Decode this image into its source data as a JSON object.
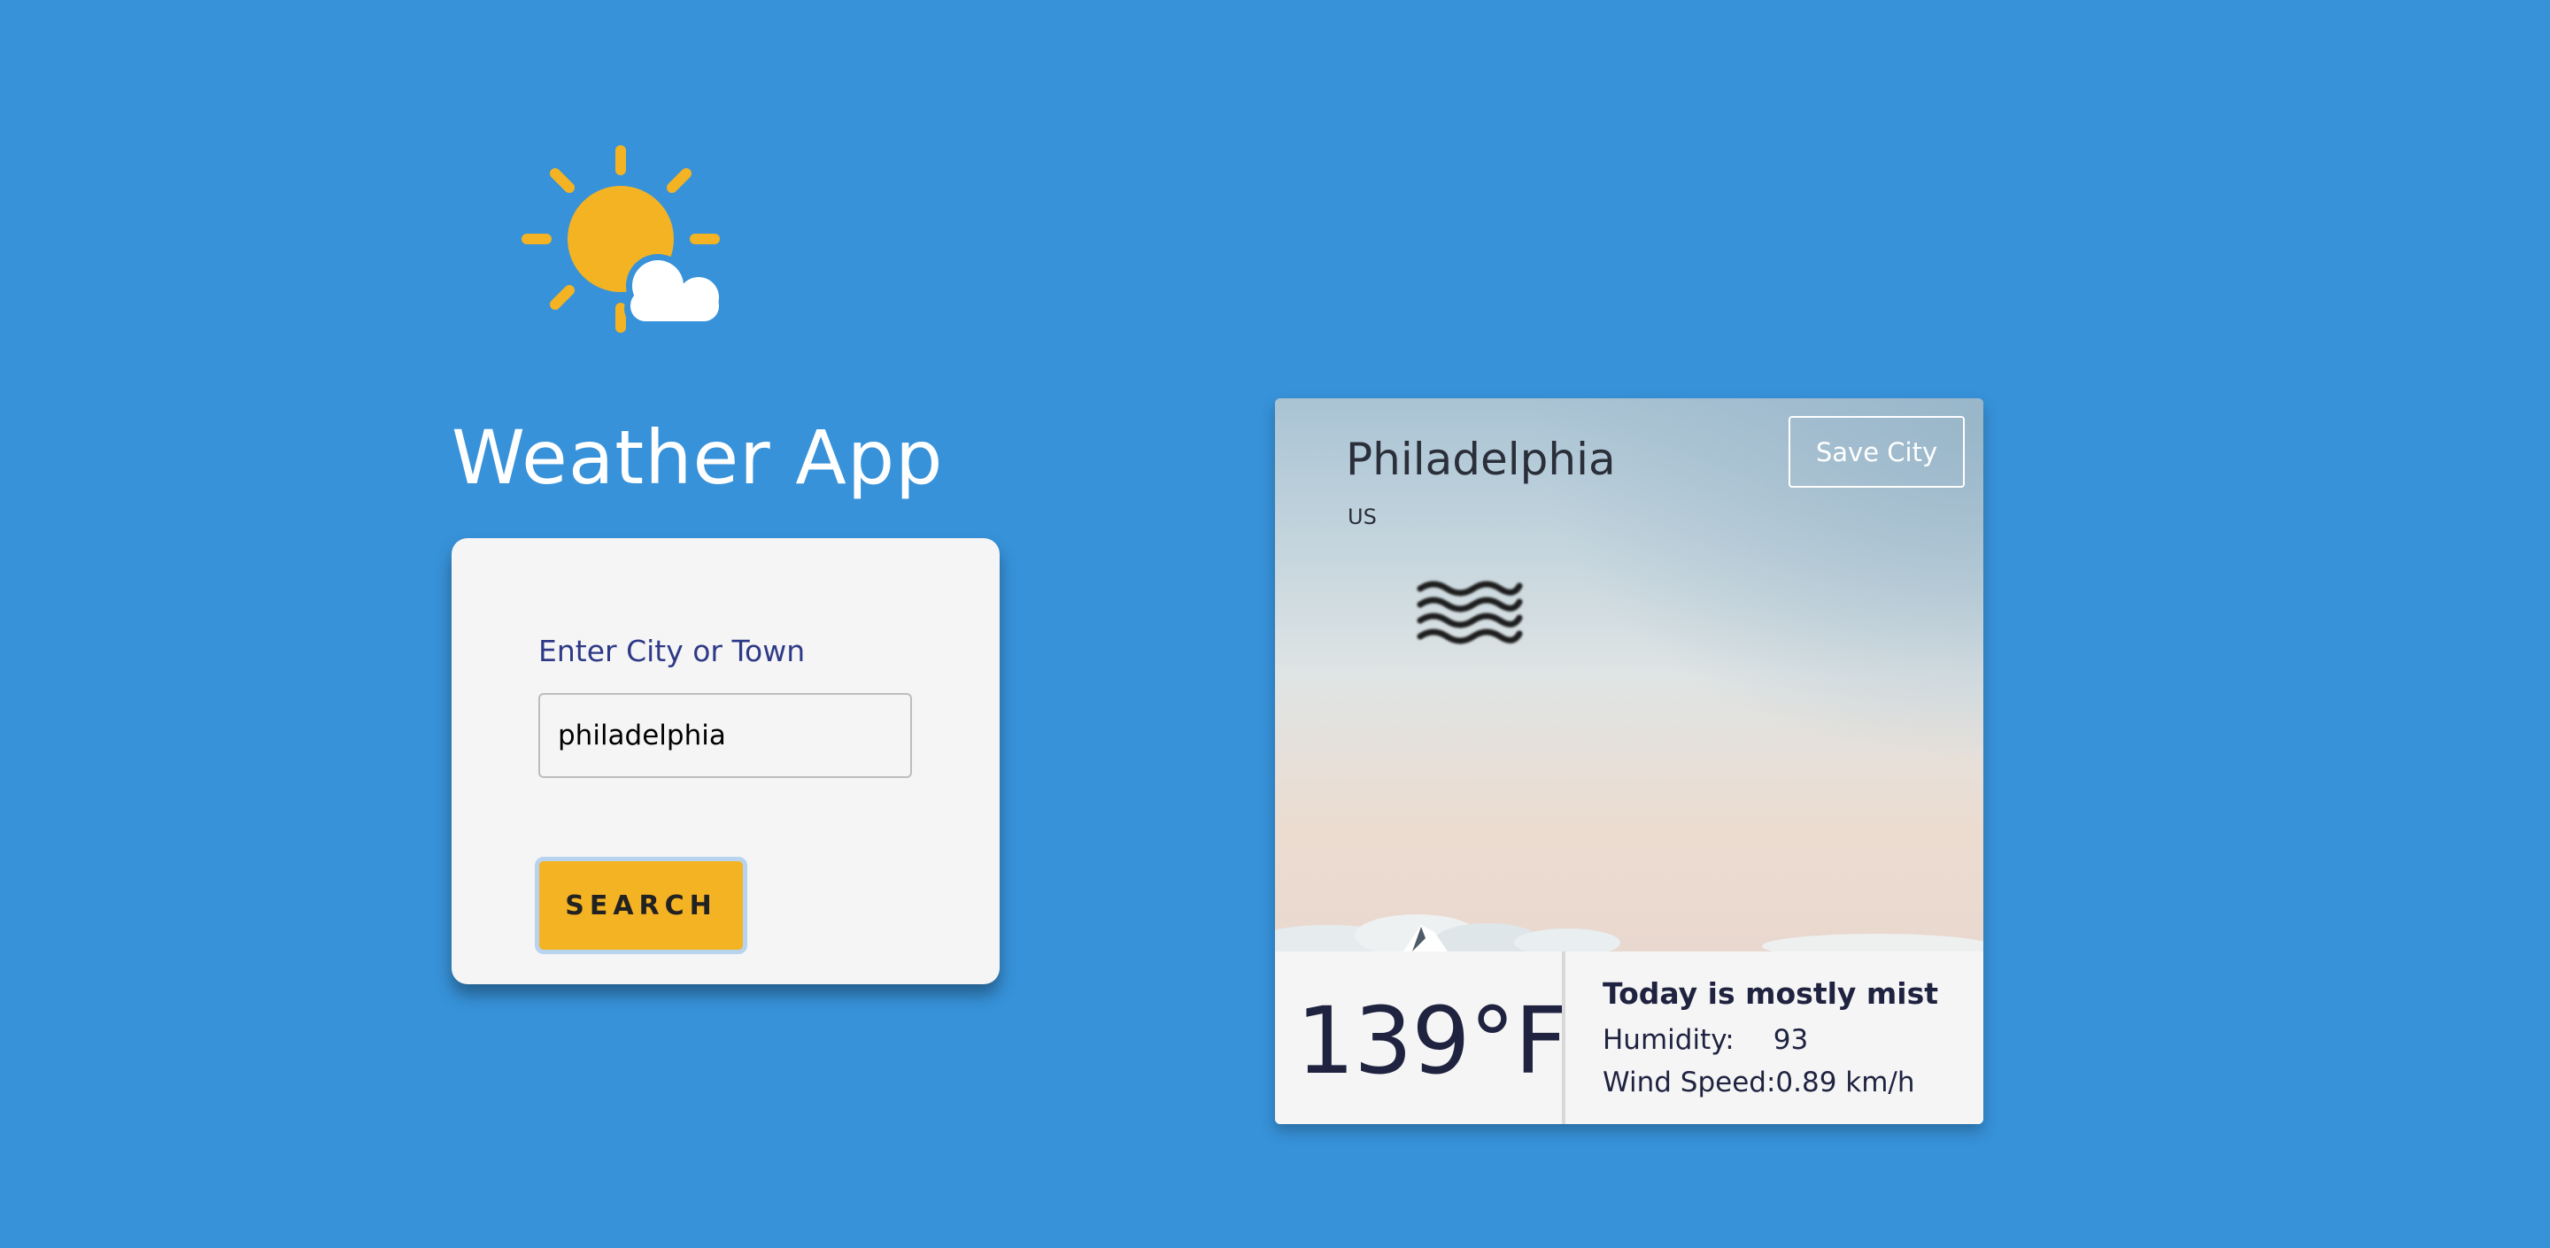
{
  "app": {
    "title": "Weather App"
  },
  "search": {
    "label": "Enter City or Town",
    "input_value": "philadelphia",
    "button_label": "SEARCH"
  },
  "weather": {
    "city": "Philadelphia",
    "country": "US",
    "save_label": "Save City",
    "condition_icon": "mist-icon",
    "temperature": "139°F",
    "description": "Today is mostly mist",
    "humidity_label": "Humidity:",
    "humidity_value": "93",
    "wind_label": "Wind Speed:",
    "wind_value": "0.89 km/h"
  },
  "colors": {
    "background": "#3792d9",
    "accent": "#f4b323",
    "label": "#2e3a87",
    "card": "#f5f5f5"
  }
}
